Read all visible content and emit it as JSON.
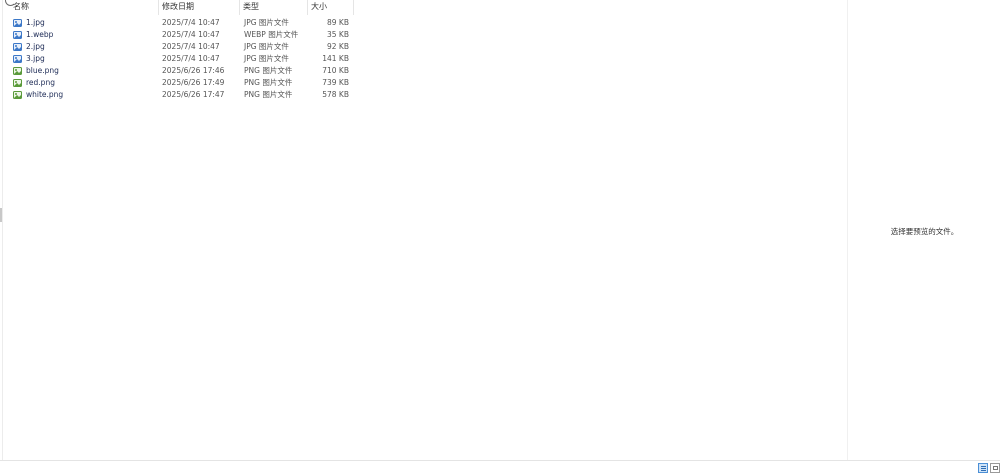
{
  "columns": {
    "name": "名称",
    "date": "修改日期",
    "type": "类型",
    "size": "大小"
  },
  "files": [
    {
      "name": "1.jpg",
      "date": "2025/7/4 10:47",
      "type": "JPG 图片文件",
      "size": "89 KB",
      "icon": "jpg-file-icon"
    },
    {
      "name": "1.webp",
      "date": "2025/7/4 10:47",
      "type": "WEBP 图片文件",
      "size": "35 KB",
      "icon": "webp-file-icon"
    },
    {
      "name": "2.jpg",
      "date": "2025/7/4 10:47",
      "type": "JPG 图片文件",
      "size": "92 KB",
      "icon": "jpg-file-icon"
    },
    {
      "name": "3.jpg",
      "date": "2025/7/4 10:47",
      "type": "JPG 图片文件",
      "size": "141 KB",
      "icon": "jpg-file-icon"
    },
    {
      "name": "blue.png",
      "date": "2025/6/26 17:46",
      "type": "PNG 图片文件",
      "size": "710 KB",
      "icon": "png-file-icon"
    },
    {
      "name": "red.png",
      "date": "2025/6/26 17:49",
      "type": "PNG 图片文件",
      "size": "739 KB",
      "icon": "png-file-icon"
    },
    {
      "name": "white.png",
      "date": "2025/6/26 17:47",
      "type": "PNG 图片文件",
      "size": "578 KB",
      "icon": "png-file-icon"
    }
  ],
  "preview": {
    "message": "选择要预览的文件。"
  },
  "colors": {
    "jpg_icon": "#3c78c8",
    "png_icon": "#5a9a3a",
    "selected_view": "#4b8fd6"
  }
}
